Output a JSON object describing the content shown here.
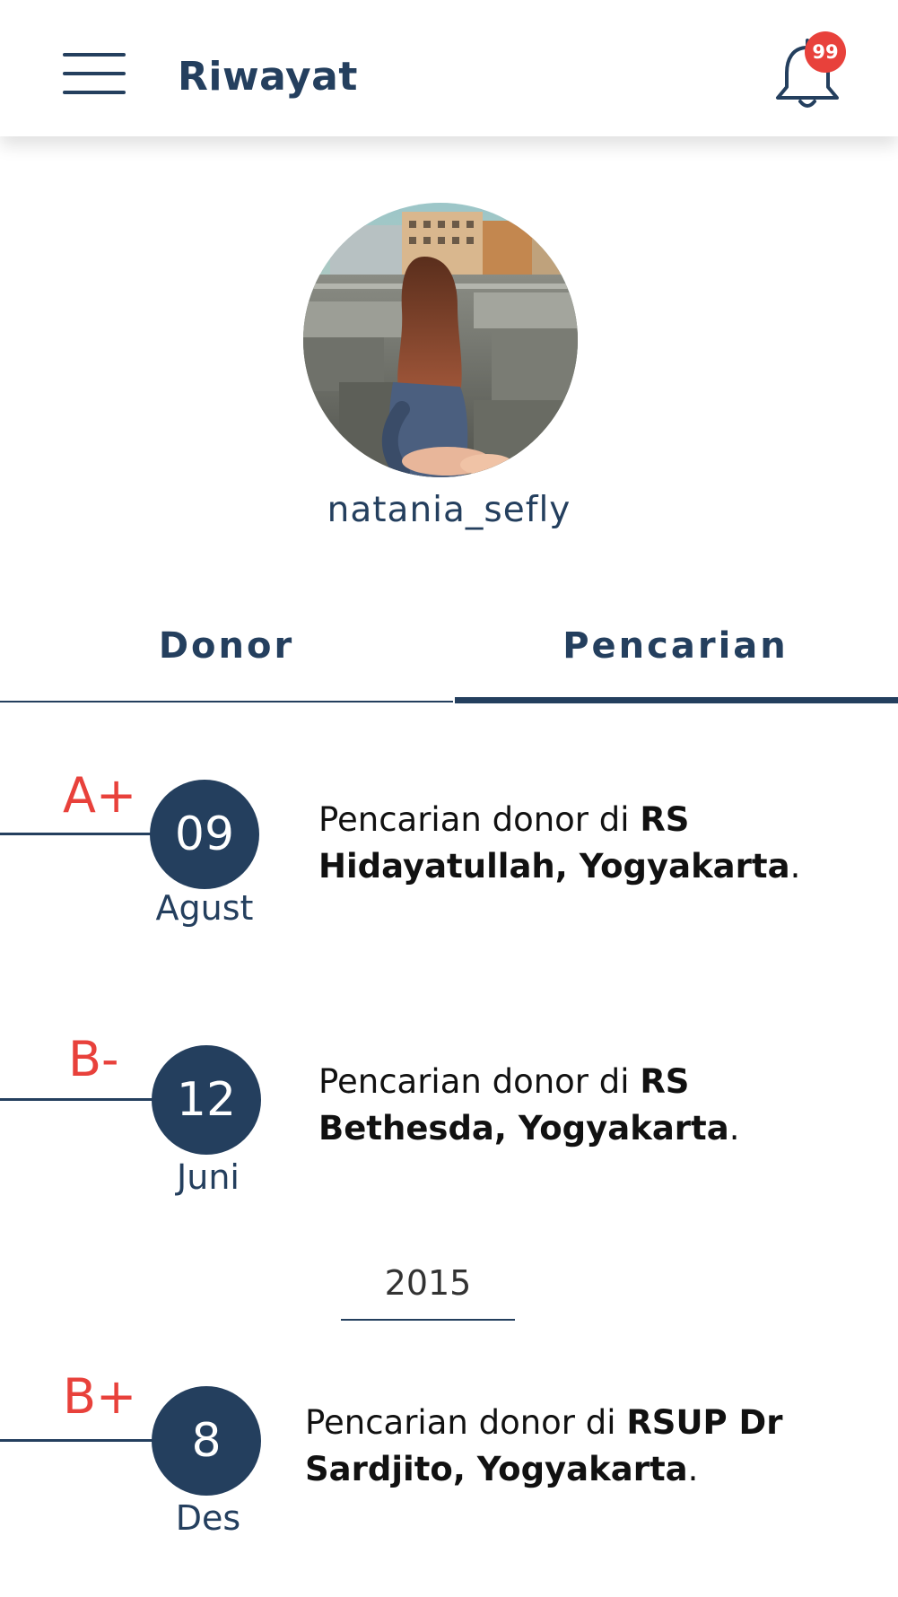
{
  "header": {
    "title": "Riwayat",
    "notification_count": "99",
    "menu_icon": "hamburger-menu-icon",
    "bell_icon": "bell-icon"
  },
  "profile": {
    "username": "natania_sefly",
    "avatar": "profile-photo"
  },
  "tabs": [
    {
      "label": "Donor",
      "active": false
    },
    {
      "label": "Pencarian",
      "active": true
    }
  ],
  "history": [
    {
      "blood_type": "A+",
      "day": "09",
      "month": "Agust",
      "text_prefix": "Pencarian donor di ",
      "location": "RS Hidayatullah, Yogyakarta",
      "suffix": "."
    },
    {
      "blood_type": "B-",
      "day": "12",
      "month": "Juni",
      "text_prefix": "Pencarian donor di ",
      "location": "RS Bethesda, Yogyakarta",
      "suffix": "."
    },
    {
      "blood_type": "B+",
      "day": "8",
      "month": "Des",
      "text_prefix": "Pencarian donor di ",
      "location": "RSUP Dr Sardjito, Yogyakarta",
      "suffix": "."
    }
  ],
  "year_separator": "2015",
  "colors": {
    "primary": "#243f5e",
    "accent": "#e8413b",
    "background": "#ffffff"
  }
}
